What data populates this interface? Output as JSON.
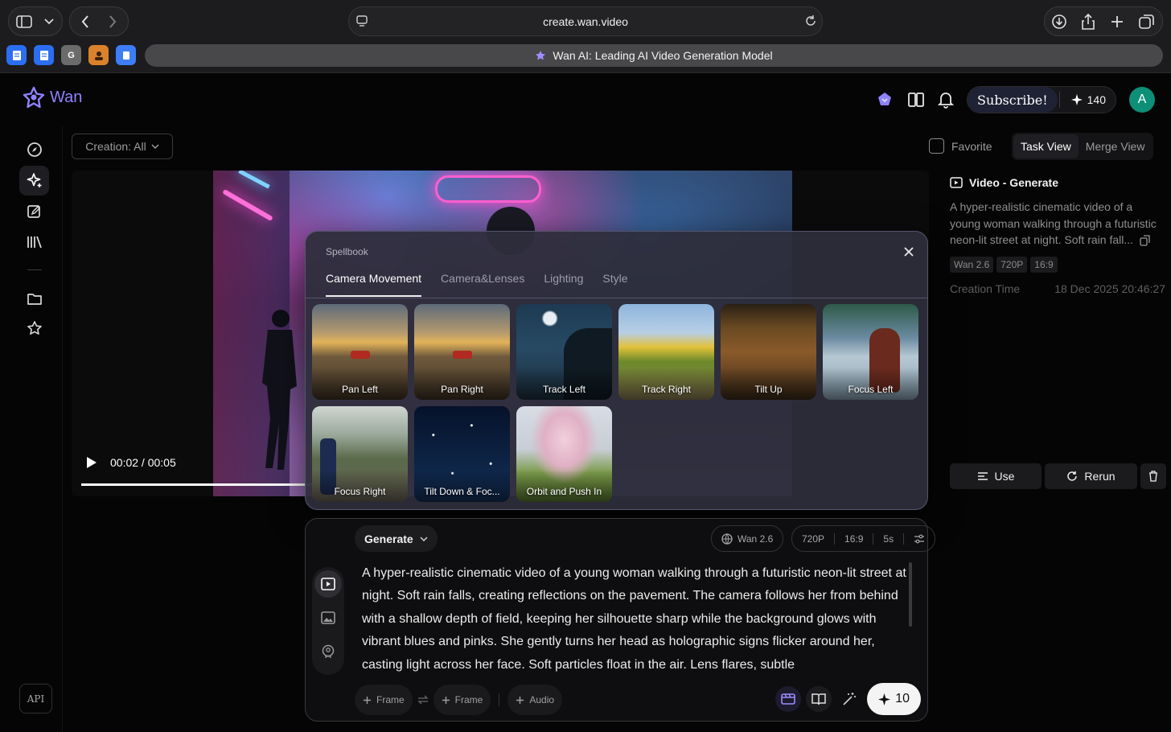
{
  "browser": {
    "url": "create.wan.video",
    "tab_title": "Wan AI: Leading AI Video Generation Model",
    "favorites": [
      {
        "letter": "",
        "color": "#2c6ef2"
      },
      {
        "letter": "",
        "color": "#2c6ef2"
      },
      {
        "letter": "G",
        "color": "#6b6b6b"
      },
      {
        "letter": "",
        "color": "#d9822b"
      },
      {
        "letter": "",
        "color": "#3d7df5"
      }
    ]
  },
  "brand": {
    "name": "Wan",
    "color": "#8f83ff"
  },
  "header": {
    "subscribe_label": "Subscribe!",
    "credits": "140",
    "avatar_letter": "A"
  },
  "toolbar": {
    "filter_label": "Creation: All",
    "favorite_label": "Favorite",
    "task_view_label": "Task View",
    "merge_view_label": "Merge View"
  },
  "sidebar": {
    "api_label": "API"
  },
  "player": {
    "time": "00:02 / 00:05",
    "progress": 0.4
  },
  "spellbook": {
    "title": "Spellbook",
    "tabs": [
      "Camera Movement",
      "Camera&Lenses",
      "Lighting",
      "Style"
    ],
    "active_tab": "Camera Movement",
    "cards": [
      {
        "label": "Pan Left"
      },
      {
        "label": "Pan Right"
      },
      {
        "label": "Track Left"
      },
      {
        "label": "Track Right"
      },
      {
        "label": "Tilt Up"
      },
      {
        "label": "Focus Left"
      },
      {
        "label": "Focus Right"
      },
      {
        "label": "Tilt Down & Foc..."
      },
      {
        "label": "Orbit and Push In"
      }
    ]
  },
  "prompt": {
    "mode_label": "Generate",
    "model": "Wan 2.6",
    "resolution": "720P",
    "ratio": "16:9",
    "duration": "5s",
    "text": "A hyper-realistic cinematic video of a young woman walking through a futuristic neon-lit street at night. Soft rain falls, creating reflections on the pavement. The camera follows her from behind with a shallow depth of field, keeping her silhouette sharp while the background glows with vibrant blues and pinks. She gently turns her head as holographic signs flicker around her, casting light across her face. Soft particles float in the air. Lens flares, subtle",
    "frame_label_1": "Frame",
    "frame_label_2": "Frame",
    "audio_label": "Audio",
    "generate_cost": "10"
  },
  "detail": {
    "heading": "Video - Generate",
    "description": "A hyper-realistic cinematic video of a young woman walking through a futuristic neon-lit street at night. Soft rain fall...",
    "tags": [
      "Wan 2.6",
      "720P",
      "16:9"
    ],
    "creation_time_label": "Creation Time",
    "creation_time": "18 Dec 2025 20:46:27",
    "use_label": "Use",
    "rerun_label": "Rerun"
  }
}
